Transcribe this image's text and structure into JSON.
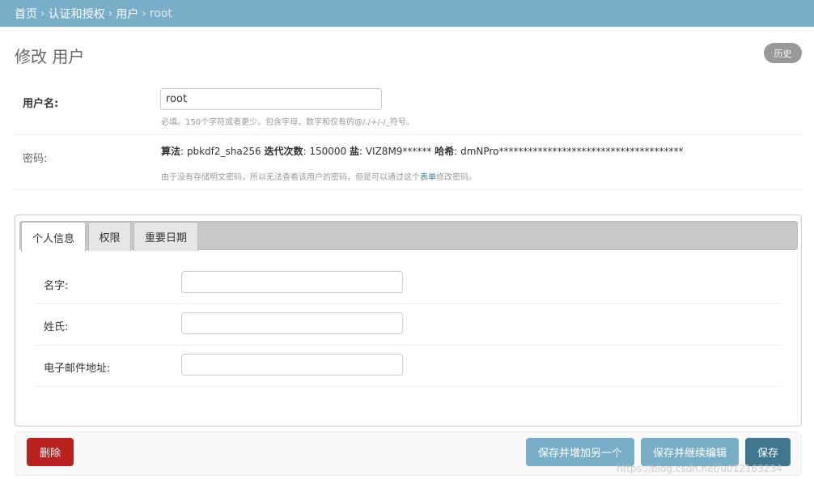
{
  "breadcrumbs": {
    "home": "首页",
    "section": "认证和授权",
    "model": "用户",
    "current": "root",
    "separator": "›"
  },
  "header": {
    "title": "修改 用户",
    "history_label": "历史"
  },
  "username": {
    "label": "用户名:",
    "value": "root",
    "help": "必填。150个字符或者更少。包含字母，数字和仅有的@/./+/-/_符号。"
  },
  "password": {
    "label": "密码:",
    "algorithm_label": "算法",
    "algorithm_value": ": pbkdf2_sha256 ",
    "iterations_label": "迭代次数",
    "iterations_value": ": 150000 ",
    "salt_label": "盐",
    "salt_value": ": VIZ8M9****** ",
    "hash_label": "哈希",
    "hash_value": ": dmNPro**************************************",
    "help_before": "由于没有存储明文密码，所以无法查看该用户的密码，但是可以通过这个",
    "help_link": "表单",
    "help_after": "修改密码。"
  },
  "tabs": [
    {
      "label": "个人信息",
      "active": true
    },
    {
      "label": "权限",
      "active": false
    },
    {
      "label": "重要日期",
      "active": false
    }
  ],
  "personal_info": {
    "first_name_label": "名字:",
    "first_name_value": "",
    "last_name_label": "姓氏:",
    "last_name_value": "",
    "email_label": "电子邮件地址:",
    "email_value": ""
  },
  "submit": {
    "delete_label": "删除",
    "save_add_label": "保存并增加另一个",
    "save_continue_label": "保存并继续编辑",
    "save_label": "保存"
  },
  "watermark": "https://blog.csdn.net/u012163234",
  "colors": {
    "header_bg": "#79aec8",
    "delete": "#ba2121",
    "primary": "#417690",
    "secondary": "#79aec8"
  }
}
